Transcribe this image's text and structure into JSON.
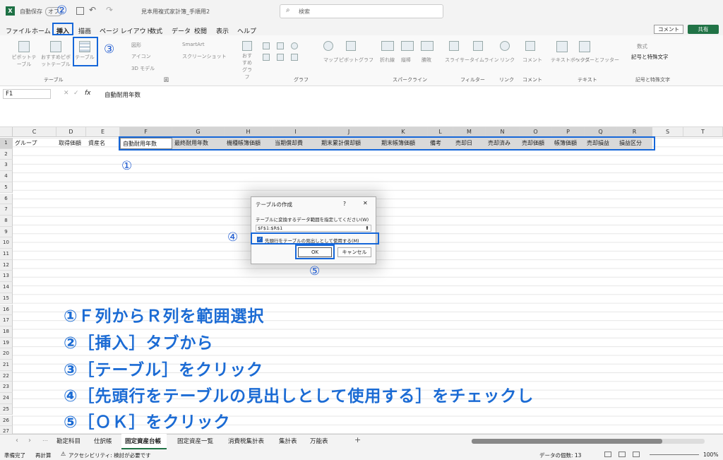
{
  "titlebar": {
    "autosave": "自動保存",
    "autosave_state": "オフ",
    "filename": "見本用複式家計簿_手順用2",
    "search_placeholder": "検索"
  },
  "menu": [
    "ファイル",
    "ホーム",
    "挿入",
    "描画",
    "ページ レイアウト",
    "数式",
    "データ",
    "校閲",
    "表示",
    "ヘルプ"
  ],
  "comment_button": "コメント",
  "share_button": "共有",
  "ribbon": {
    "groups": {
      "table": "テーブル",
      "illustrations": "図",
      "charts": "グラフ",
      "sparklines": "スパークライン",
      "filters": "フィルター",
      "links": "リンク",
      "comments": "コメント",
      "text": "テキスト",
      "symbols": "記号と特殊文字"
    },
    "pivot": "ピボットテーブル",
    "rec_pivot": "おすすめピボットテーブル",
    "table_btn": "テーブル",
    "shapes": "図形",
    "icons": "アイコン",
    "models3d": "3D モデル",
    "smartart": "SmartArt",
    "screenshot": "スクリーンショット",
    "rec_charts": "おすすめグラフ",
    "maps": "マップ",
    "pivot_chart": "ピボットグラフ",
    "spark_line": "折れ線",
    "spark_col": "縦棒",
    "spark_wl": "勝敗",
    "slicer": "スライサー",
    "timeline": "タイムライン",
    "link": "リンク",
    "comment": "コメント",
    "textbox": "テキストボックス",
    "header_footer": "ヘッダーとフッター",
    "equation": "数式",
    "symbol": "記号と特殊文字"
  },
  "formula_bar": {
    "name_box": "F1",
    "fx": "fx",
    "content": "自動耐用年数"
  },
  "columns": [
    "C",
    "D",
    "E",
    "F",
    "G",
    "H",
    "I",
    "J",
    "K",
    "L",
    "M",
    "N",
    "O",
    "P",
    "Q",
    "R",
    "S",
    "T"
  ],
  "row1": {
    "C": "グループ",
    "D": "取得価額",
    "E": "資産名",
    "F": "自動耐用年数",
    "G": "最終耐用年数",
    "H": "機種帳簿価額",
    "I": "当期償却費",
    "J": "期末累計償却額",
    "K": "期末帳簿価額",
    "L": "備考",
    "M": "売却日",
    "N": "売却済み",
    "O": "売却価額",
    "P": "帳簿価額",
    "Q": "売却損益",
    "R": "損益区分"
  },
  "rows": [
    "1",
    "2",
    "3",
    "4",
    "5",
    "6",
    "7",
    "8",
    "9",
    "10",
    "11",
    "12",
    "13",
    "14",
    "15",
    "16",
    "17",
    "18",
    "19",
    "20",
    "21",
    "22",
    "23",
    "24",
    "25",
    "26",
    "27"
  ],
  "dialog": {
    "title": "テーブルの作成",
    "help": "?",
    "close": "✕",
    "prompt": "テーブルに変換するデータ範囲を指定してください(W)",
    "range": "$F$1:$R$1",
    "checkbox": "先頭行をテーブルの見出しとして使用する(M)",
    "ok": "OK",
    "cancel": "キャンセル"
  },
  "markers": {
    "m1": "①",
    "m2": "②",
    "m3": "③",
    "m4": "④",
    "m5": "⑤"
  },
  "instructions": [
    "①Ｆ列からＲ列を範囲選択",
    "②［挿入］タブから",
    "③［テーブル］をクリック",
    "④［先頭行をテーブルの見出しとして使用する］をチェックし",
    "⑤［ＯＫ］をクリック"
  ],
  "sheet_tabs": [
    "勘定科目",
    "仕訳帳",
    "固定資産台帳",
    "固定資産一覧",
    "消費税集計表",
    "集計表",
    "万能表"
  ],
  "status": {
    "ready": "準備完了",
    "recalc": "再計算",
    "accessibility": "アクセシビリティ: 検討が必要です",
    "count": "データの個数: 13",
    "zoom": "100%"
  },
  "colors": {
    "accent": "#1667d9",
    "excel_green": "#217346"
  }
}
